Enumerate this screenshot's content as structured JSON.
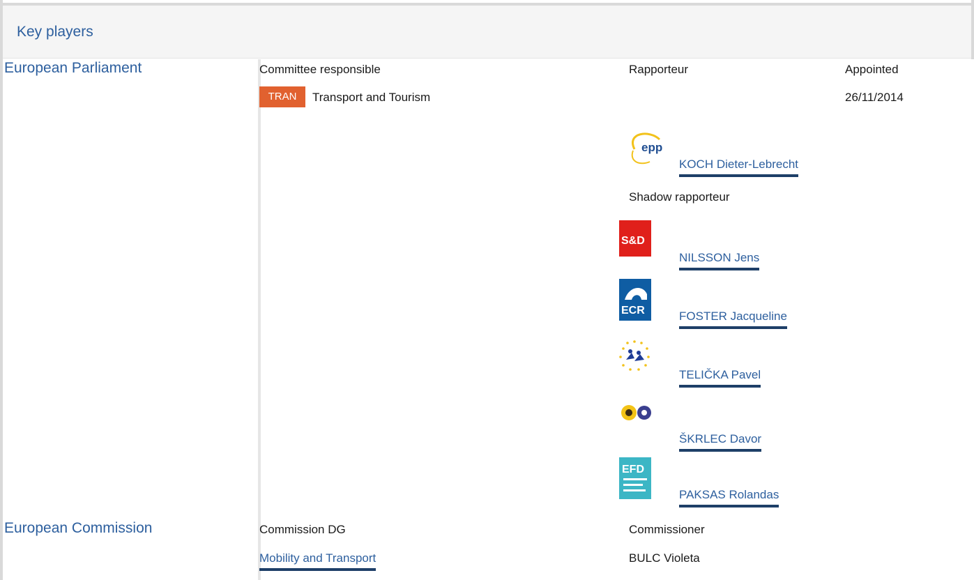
{
  "header": {
    "title": "Key players"
  },
  "parliament": {
    "title": "European Parliament",
    "col_committee": "Committee responsible",
    "col_rapporteur": "Rapporteur",
    "col_appointed": "Appointed",
    "committee_badge": "TRAN",
    "committee_name": "Transport and Tourism",
    "appointed_date": "26/11/2014",
    "rapporteur": {
      "name": "KOCH Dieter-Lebrecht",
      "group_logo": "epp-logo",
      "logo_text": "epp"
    },
    "shadow_label": "Shadow rapporteur",
    "shadows": [
      {
        "name": "NILSSON Jens",
        "group_logo": "sd-logo",
        "logo_text": "S&D"
      },
      {
        "name": "FOSTER Jacqueline",
        "group_logo": "ecr-logo",
        "logo_text": "ECR"
      },
      {
        "name": "TELIČKA Pavel",
        "group_logo": "alde-logo"
      },
      {
        "name": "ŠKRLEC Davor",
        "group_logo": "greens-efa-logo"
      },
      {
        "name": "PAKSAS Rolandas",
        "group_logo": "efdd-logo",
        "logo_text": "EFD"
      }
    ]
  },
  "commission": {
    "title": "European Commission",
    "col_dg": "Commission DG",
    "col_commissioner": "Commissioner",
    "dg_name": "Mobility and Transport",
    "commissioner_name": "BULC Violeta"
  },
  "colors": {
    "accent": "#2d5f9e",
    "badge": "#e1612f",
    "sd": "#e0201b",
    "ecr": "#0f5da3",
    "efdd": "#3cb6c5"
  }
}
